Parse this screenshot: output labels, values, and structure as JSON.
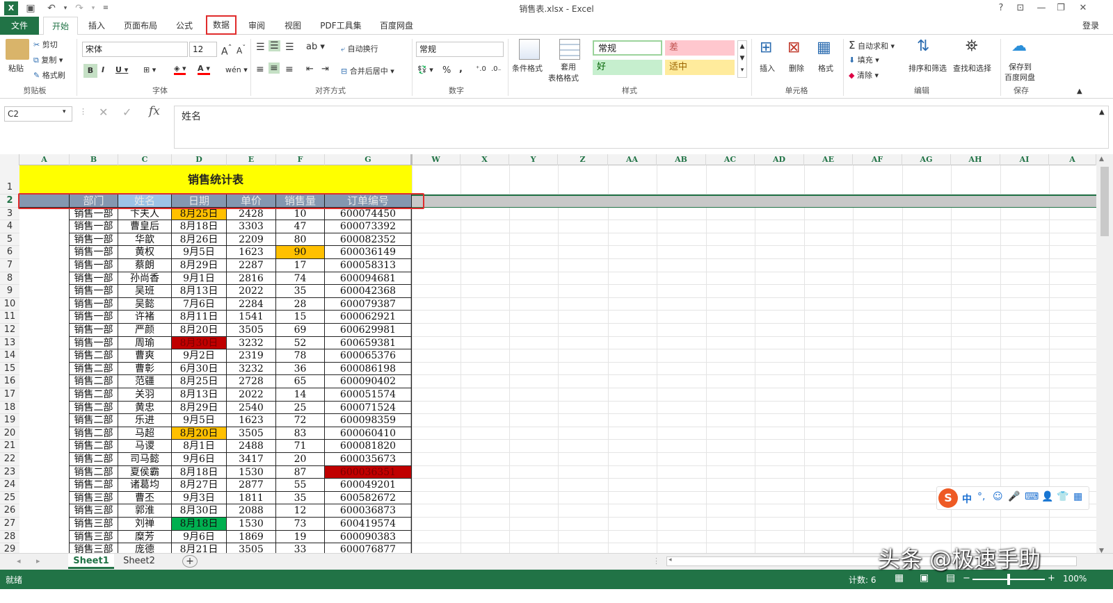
{
  "window": {
    "title": "销售表.xlsx - Excel",
    "help": "?",
    "login": "登录"
  },
  "tabs": {
    "file": "文件",
    "home": "开始",
    "insert": "插入",
    "layout": "页面布局",
    "formula": "公式",
    "data": "数据",
    "review": "审阅",
    "view": "视图",
    "pdf": "PDF工具集",
    "baidu": "百度网盘"
  },
  "ribbon": {
    "paste": "粘贴",
    "cut": "剪切",
    "copy": "复制",
    "format_painter": "格式刷",
    "clipboard": "剪贴板",
    "font_name": "宋体",
    "font_size": "12",
    "font_group": "字体",
    "wrap": "自动换行",
    "merge": "合并后居中",
    "align_group": "对齐方式",
    "number_format": "常规",
    "number_group": "数字",
    "percent": "%",
    "comma": ",",
    "cond_format": "条件格式",
    "table_format_1": "套用",
    "table_format_2": "表格格式",
    "style_normal": "常规",
    "style_bad": "差",
    "style_good": "好",
    "style_neutral": "适中",
    "styles_group": "样式",
    "insert": "插入",
    "delete": "删除",
    "format": "格式",
    "cells_group": "单元格",
    "autosum": "自动求和",
    "fill": "填充",
    "clear": "清除",
    "sort": "排序和筛选",
    "find": "查找和选择",
    "edit_group": "编辑",
    "save_baidu_1": "保存到",
    "save_baidu_2": "百度网盘",
    "save_group": "保存"
  },
  "formula_bar": {
    "name_box": "C2",
    "content": "姓名",
    "fx": "fx"
  },
  "columns": [
    "A",
    "B",
    "C",
    "D",
    "E",
    "F",
    "G",
    "W",
    "X",
    "Y",
    "Z",
    "AA",
    "AB",
    "AC",
    "AD",
    "AE",
    "AF",
    "AG",
    "AH",
    "AI",
    "A"
  ],
  "sheet_title": "销售统计表",
  "headers": [
    "部门",
    "姓名",
    "日期",
    "单价",
    "销售量",
    "订单编号"
  ],
  "rows": [
    [
      "销售一部",
      "卞夫人",
      "8月25日",
      "2428",
      "10",
      "600074450"
    ],
    [
      "销售一部",
      "曹皇后",
      "8月18日",
      "3303",
      "47",
      "600073392"
    ],
    [
      "销售一部",
      "华歆",
      "8月26日",
      "2209",
      "80",
      "600082352"
    ],
    [
      "销售一部",
      "黄权",
      "9月5日",
      "1623",
      "90",
      "600036149"
    ],
    [
      "销售一部",
      "蔡朗",
      "8月29日",
      "2287",
      "17",
      "600058313"
    ],
    [
      "销售一部",
      "孙尚香",
      "9月1日",
      "2816",
      "74",
      "600094681"
    ],
    [
      "销售一部",
      "吴班",
      "8月13日",
      "2022",
      "35",
      "600042368"
    ],
    [
      "销售一部",
      "吴懿",
      "7月6日",
      "2284",
      "28",
      "600079387"
    ],
    [
      "销售一部",
      "许褚",
      "8月11日",
      "1541",
      "15",
      "600062921"
    ],
    [
      "销售一部",
      "严颜",
      "8月20日",
      "3505",
      "69",
      "600629981"
    ],
    [
      "销售一部",
      "周瑜",
      "8月30日",
      "3232",
      "52",
      "600659381"
    ],
    [
      "销售二部",
      "曹爽",
      "9月2日",
      "2319",
      "78",
      "600065376"
    ],
    [
      "销售二部",
      "曹彰",
      "6月30日",
      "3232",
      "36",
      "600086198"
    ],
    [
      "销售二部",
      "范疆",
      "8月25日",
      "2728",
      "65",
      "600090402"
    ],
    [
      "销售二部",
      "关羽",
      "8月13日",
      "2022",
      "14",
      "600051574"
    ],
    [
      "销售二部",
      "黄忠",
      "8月29日",
      "2540",
      "25",
      "600071524"
    ],
    [
      "销售二部",
      "乐进",
      "9月5日",
      "1623",
      "72",
      "600098359"
    ],
    [
      "销售二部",
      "马超",
      "8月20日",
      "3505",
      "83",
      "600060410"
    ],
    [
      "销售二部",
      "马谡",
      "8月1日",
      "2488",
      "71",
      "600081820"
    ],
    [
      "销售二部",
      "司马懿",
      "9月6日",
      "3417",
      "20",
      "600035673"
    ],
    [
      "销售二部",
      "夏侯霸",
      "8月18日",
      "1530",
      "87",
      "600036351"
    ],
    [
      "销售二部",
      "诸葛均",
      "8月27日",
      "2877",
      "55",
      "600049201"
    ],
    [
      "销售三部",
      "曹丕",
      "9月3日",
      "1811",
      "35",
      "600582672"
    ],
    [
      "销售三部",
      "郭淮",
      "8月30日",
      "2088",
      "12",
      "600036873"
    ],
    [
      "销售三部",
      "刘禅",
      "8月18日",
      "1530",
      "73",
      "600419574"
    ],
    [
      "销售三部",
      "糜芳",
      "9月6日",
      "1869",
      "19",
      "600090383"
    ],
    [
      "销售三部",
      "庞德",
      "8月21日",
      "3505",
      "33",
      "600076877"
    ]
  ],
  "highlights": [
    {
      "row": 1,
      "col": 2,
      "color": "#ffc000"
    },
    {
      "row": 4,
      "col": 4,
      "color": "#ffc000"
    },
    {
      "row": 11,
      "col": 2,
      "color": "#c00000"
    },
    {
      "row": 18,
      "col": 2,
      "color": "#ffc000"
    },
    {
      "row": 21,
      "col": 5,
      "color": "#c00000"
    },
    {
      "row": 25,
      "col": 2,
      "color": "#00b050"
    }
  ],
  "sheets": {
    "s1": "Sheet1",
    "s2": "Sheet2",
    "add": "+"
  },
  "status": {
    "ready": "就绪",
    "count": "计数: 6",
    "zoom": "100%"
  },
  "ime": {
    "label": "中"
  },
  "watermark": "头条 @极速手助",
  "colors": {
    "accent": "#217346",
    "highlight_frame": "#e02b2b",
    "title_fill": "#ffff00",
    "header_fill": "#8497b0"
  }
}
